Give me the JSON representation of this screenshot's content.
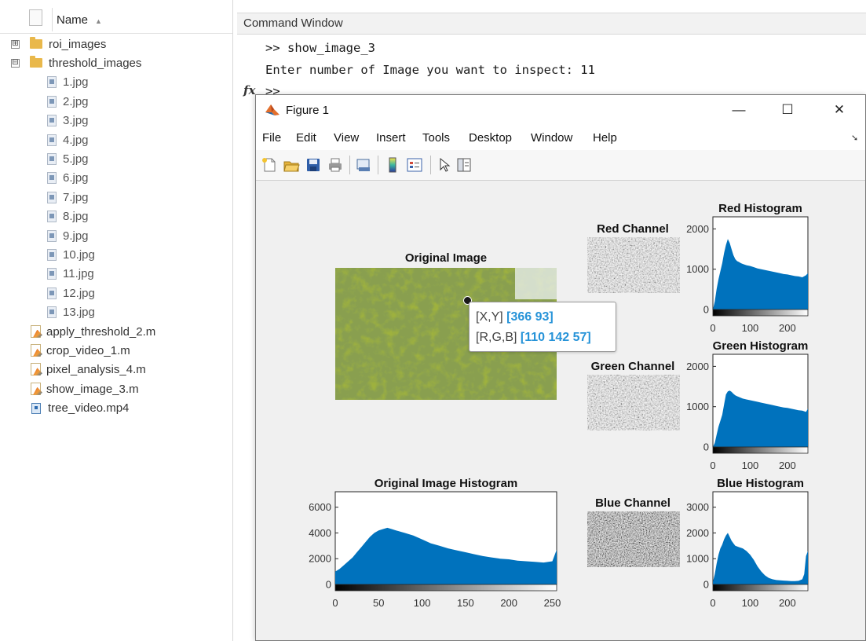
{
  "browser": {
    "header_label": "Name",
    "sort_indicator": "▲",
    "folders": [
      {
        "label": "roi_images",
        "expander": "⊞"
      },
      {
        "label": "threshold_images",
        "expander": "⊟"
      }
    ],
    "jpg_files": [
      "1.jpg",
      "2.jpg",
      "3.jpg",
      "4.jpg",
      "5.jpg",
      "6.jpg",
      "7.jpg",
      "8.jpg",
      "9.jpg",
      "10.jpg",
      "11.jpg",
      "12.jpg",
      "13.jpg"
    ],
    "m_files": [
      "apply_threshold_2.m",
      "crop_video_1.m",
      "pixel_analysis_4.m",
      "show_image_3.m"
    ],
    "video_file": "tree_video.mp4"
  },
  "command_window": {
    "title": "Command Window",
    "lines": [
      ">> show_image_3",
      "Enter number of Image you want to inspect: 11",
      ">>"
    ],
    "fx": "fx"
  },
  "figure": {
    "title": "Figure 1",
    "window_buttons": {
      "minimize": "—",
      "maximize": "☐",
      "close": "✕"
    },
    "menus": [
      "File",
      "Edit",
      "View",
      "Insert",
      "Tools",
      "Desktop",
      "Window",
      "Help"
    ],
    "menu_overflow": "➘",
    "toolbar_icons": [
      "new-figure-icon",
      "open-file-icon",
      "save-icon",
      "print-icon",
      "link-plot-icon",
      "colorbar-icon",
      "legend-icon",
      "pointer-icon",
      "property-inspector-icon"
    ],
    "titles": {
      "original_image": "Original Image",
      "red_channel": "Red Channel",
      "green_channel": "Green Channel",
      "blue_channel": "Blue Channel",
      "red_hist": "Red Histogram",
      "green_hist": "Green Histogram",
      "blue_hist": "Blue Histogram",
      "orig_hist": "Original Image Histogram"
    },
    "datatip": {
      "xy_label": "[X,Y]",
      "xy_value": "[366 93]",
      "rgb_label": "[R,G,B]",
      "rgb_value": "[110 142 57]"
    },
    "colors": {
      "bar": "#0072bd",
      "tip_value": "#2693d8"
    }
  },
  "chart_data": [
    {
      "type": "area",
      "title": "Red Histogram",
      "x": [
        0,
        5,
        10,
        15,
        20,
        25,
        30,
        35,
        40,
        45,
        50,
        55,
        60,
        65,
        70,
        75,
        80,
        90,
        100,
        110,
        120,
        130,
        140,
        150,
        160,
        170,
        180,
        190,
        200,
        210,
        220,
        230,
        240,
        250,
        255
      ],
      "values": [
        0,
        200,
        500,
        750,
        950,
        1150,
        1400,
        1600,
        1750,
        1650,
        1500,
        1350,
        1250,
        1200,
        1180,
        1150,
        1130,
        1100,
        1080,
        1050,
        1020,
        1000,
        980,
        960,
        940,
        920,
        900,
        880,
        870,
        850,
        830,
        820,
        800,
        850,
        900
      ],
      "xlim": [
        0,
        255
      ],
      "ylim": [
        0,
        2300
      ],
      "xticks": [
        0,
        100,
        200
      ],
      "yticks": [
        0,
        1000,
        2000
      ]
    },
    {
      "type": "area",
      "title": "Green Histogram",
      "x": [
        0,
        5,
        10,
        15,
        20,
        25,
        30,
        35,
        40,
        45,
        50,
        55,
        60,
        65,
        70,
        75,
        80,
        90,
        100,
        110,
        120,
        130,
        140,
        150,
        160,
        170,
        180,
        190,
        200,
        210,
        220,
        230,
        240,
        250,
        255
      ],
      "values": [
        0,
        100,
        300,
        500,
        650,
        800,
        1050,
        1300,
        1380,
        1400,
        1370,
        1320,
        1280,
        1260,
        1240,
        1220,
        1200,
        1180,
        1160,
        1140,
        1120,
        1100,
        1080,
        1060,
        1040,
        1020,
        1000,
        980,
        970,
        950,
        930,
        910,
        900,
        870,
        950
      ],
      "xlim": [
        0,
        255
      ],
      "ylim": [
        0,
        2300
      ],
      "xticks": [
        0,
        100,
        200
      ],
      "yticks": [
        0,
        1000,
        2000
      ]
    },
    {
      "type": "area",
      "title": "Blue Histogram",
      "x": [
        0,
        5,
        10,
        15,
        20,
        25,
        30,
        35,
        40,
        45,
        50,
        55,
        60,
        70,
        80,
        90,
        100,
        110,
        120,
        130,
        140,
        150,
        160,
        170,
        180,
        190,
        200,
        210,
        220,
        230,
        240,
        245,
        250,
        255
      ],
      "values": [
        100,
        400,
        800,
        1150,
        1400,
        1550,
        1750,
        1900,
        2000,
        1850,
        1700,
        1600,
        1500,
        1450,
        1400,
        1300,
        1150,
        950,
        700,
        500,
        350,
        250,
        200,
        170,
        160,
        150,
        140,
        130,
        130,
        140,
        200,
        400,
        1100,
        1300
      ],
      "xlim": [
        0,
        255
      ],
      "ylim": [
        0,
        3600
      ],
      "xticks": [
        0,
        100,
        200
      ],
      "yticks": [
        0,
        1000,
        2000,
        3000
      ]
    },
    {
      "type": "area",
      "title": "Original Image Histogram",
      "x": [
        0,
        5,
        10,
        15,
        20,
        25,
        30,
        35,
        40,
        45,
        50,
        55,
        60,
        65,
        70,
        80,
        90,
        100,
        110,
        120,
        130,
        140,
        150,
        160,
        170,
        180,
        190,
        200,
        210,
        220,
        230,
        240,
        250,
        255
      ],
      "values": [
        1000,
        1200,
        1500,
        1800,
        2100,
        2500,
        2900,
        3300,
        3700,
        4000,
        4200,
        4300,
        4400,
        4300,
        4200,
        4000,
        3800,
        3500,
        3200,
        3000,
        2800,
        2650,
        2500,
        2350,
        2200,
        2100,
        2000,
        1950,
        1850,
        1800,
        1750,
        1700,
        1800,
        2700
      ],
      "xlim": [
        0,
        255
      ],
      "ylim": [
        0,
        7200
      ],
      "xticks": [
        0,
        50,
        100,
        150,
        200,
        250
      ],
      "yticks": [
        0,
        2000,
        4000,
        6000
      ]
    }
  ]
}
